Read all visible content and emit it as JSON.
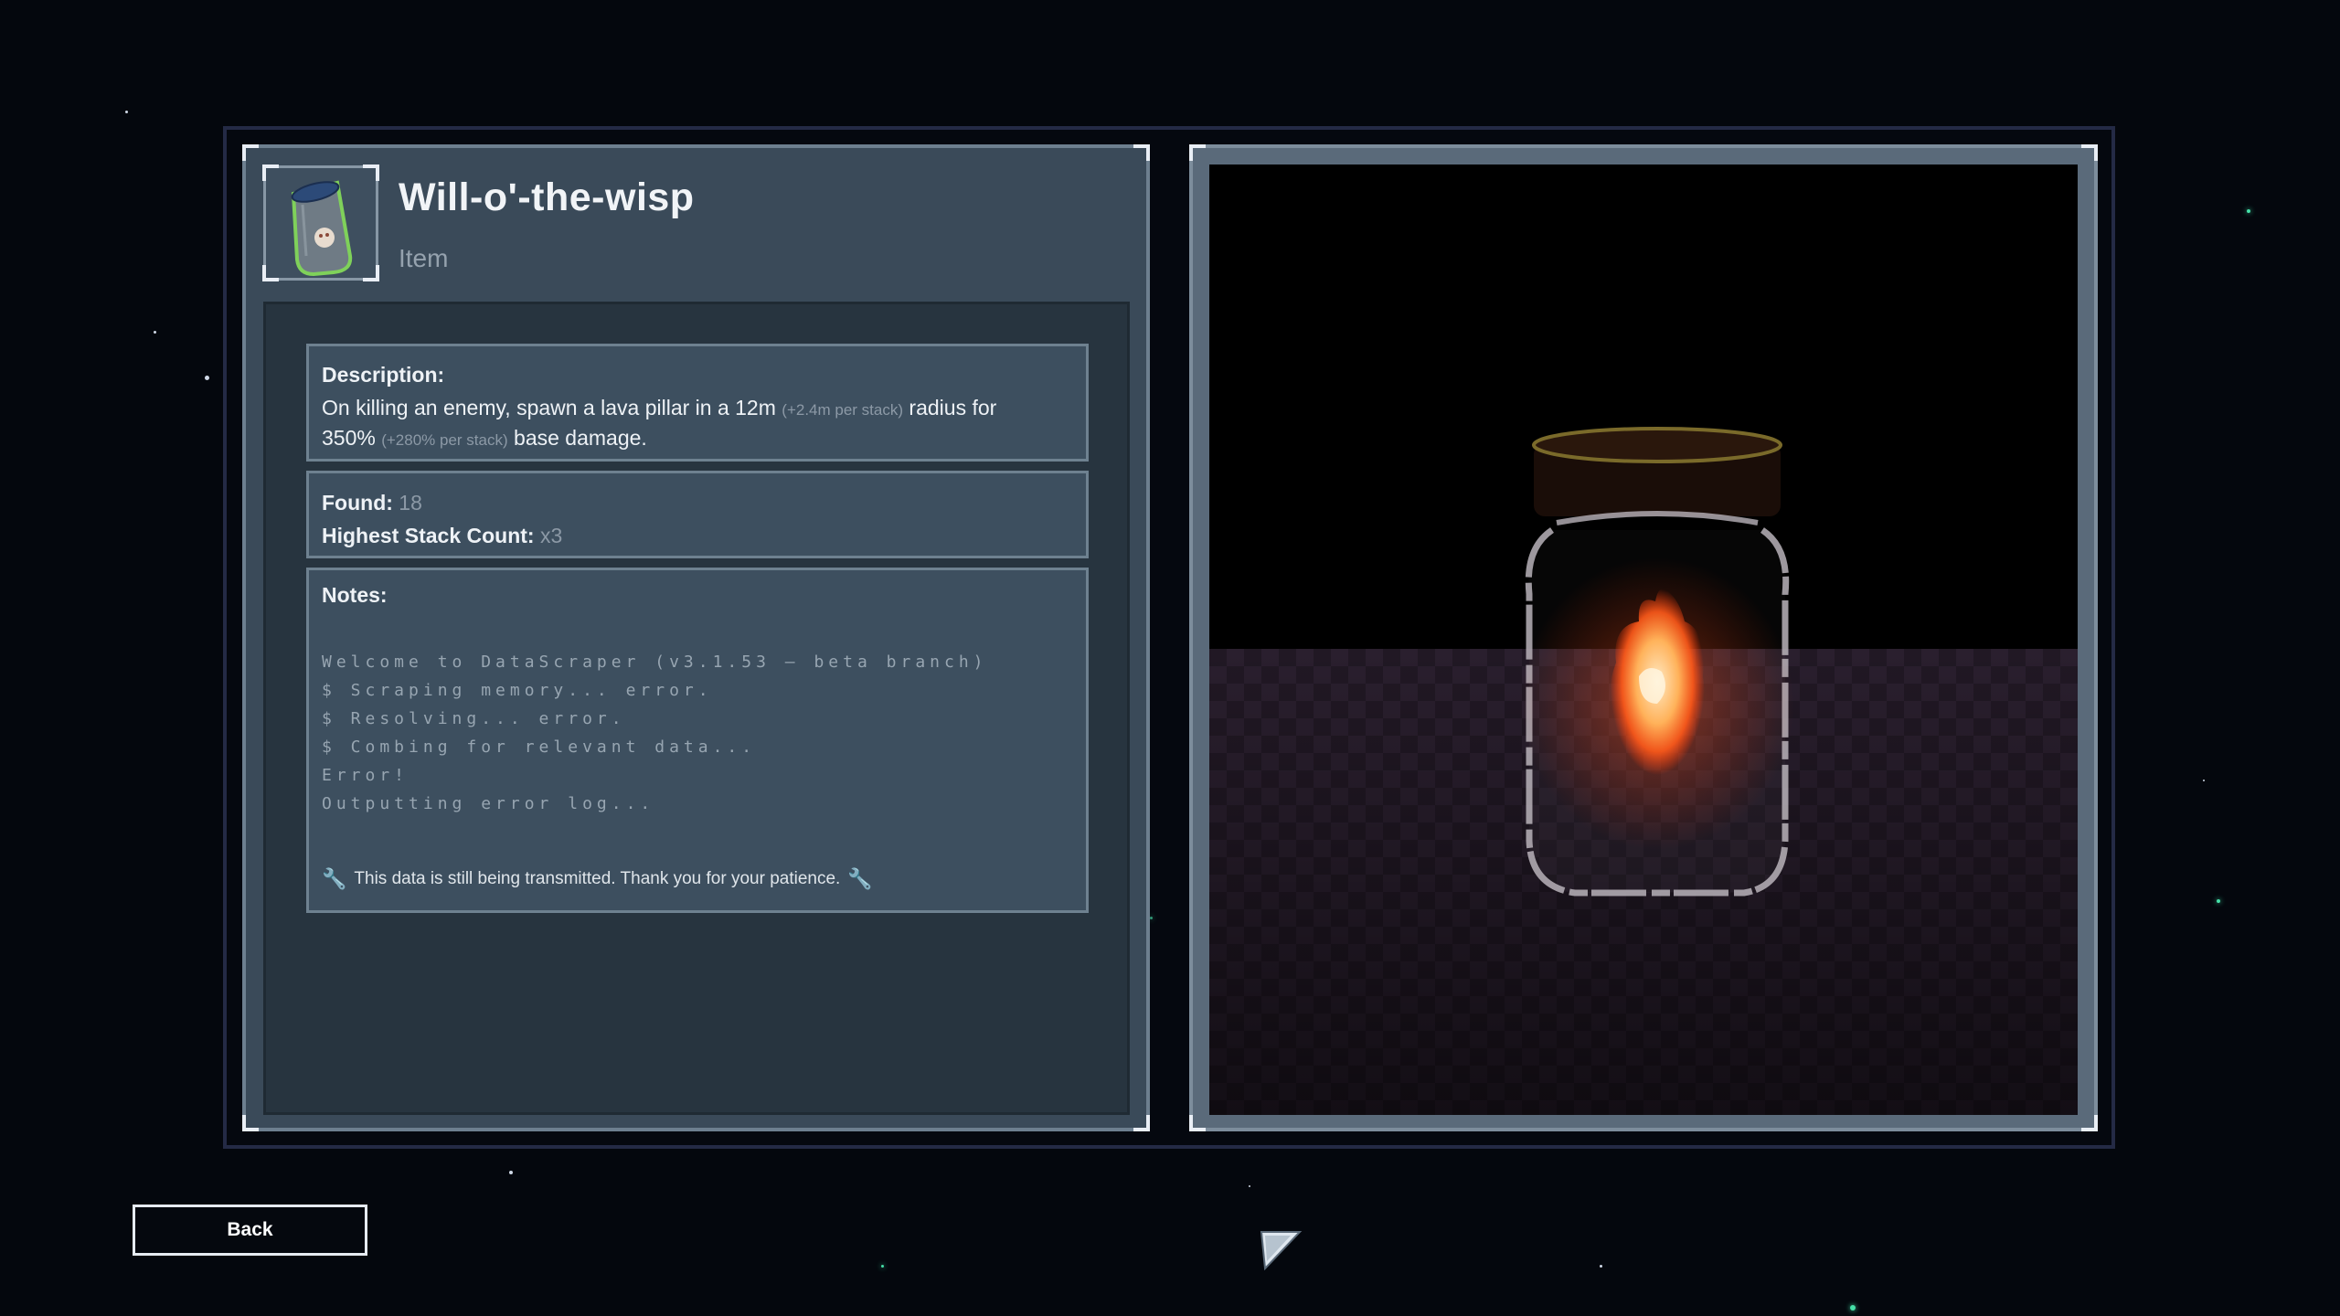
{
  "item": {
    "title": "Will-o'-the-wisp",
    "type": "Item",
    "icon": "glass-jar-icon"
  },
  "description": {
    "label": "Description:",
    "text_1": "On killing an enemy, spawn a lava pillar in a 12m",
    "stack_1": "(+2.4m per stack)",
    "text_2": "radius for",
    "text_3": "350%",
    "stack_2": "(+280% per stack)",
    "text_4": "base damage."
  },
  "stats": {
    "found_label": "Found:",
    "found_value": "18",
    "stack_label": "Highest Stack Count:",
    "stack_value": "x3"
  },
  "notes": {
    "label": "Notes:",
    "terminal_lines": [
      "Welcome to DataScraper (v3.1.53 – beta branch)",
      "$ Scraping memory... error.",
      "$ Resolving... error.",
      "$ Combing for relevant data...",
      "Error!",
      "Outputting error log..."
    ],
    "transmit_message": "This data is still being transmitted. Thank you for your patience."
  },
  "back_label": "Back",
  "colors": {
    "accent_wrench": "#f2c23c",
    "panel_bg": "#3a4a59",
    "fire": "#ff8a3a"
  }
}
